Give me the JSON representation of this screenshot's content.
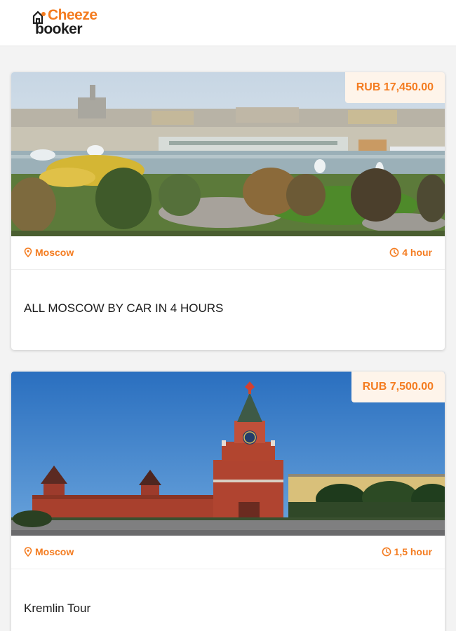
{
  "brand": {
    "logo_top": "Cheeze",
    "logo_bottom": "booker",
    "accent_color": "#f47c20"
  },
  "tours": [
    {
      "price": "RUB 17,450.00",
      "location": "Moscow",
      "location_icon": "map-pin-icon",
      "duration": "4 hour",
      "duration_icon": "clock-icon",
      "title": "ALL MOSCOW BY CAR IN 4 HOURS",
      "image": "moscow-city-panorama"
    },
    {
      "price": "RUB 7,500.00",
      "location": "Moscow",
      "location_icon": "map-pin-icon",
      "duration": "1,5 hour",
      "duration_icon": "clock-icon",
      "title": "Kremlin Tour",
      "image": "kremlin-spasskaya-tower"
    }
  ]
}
